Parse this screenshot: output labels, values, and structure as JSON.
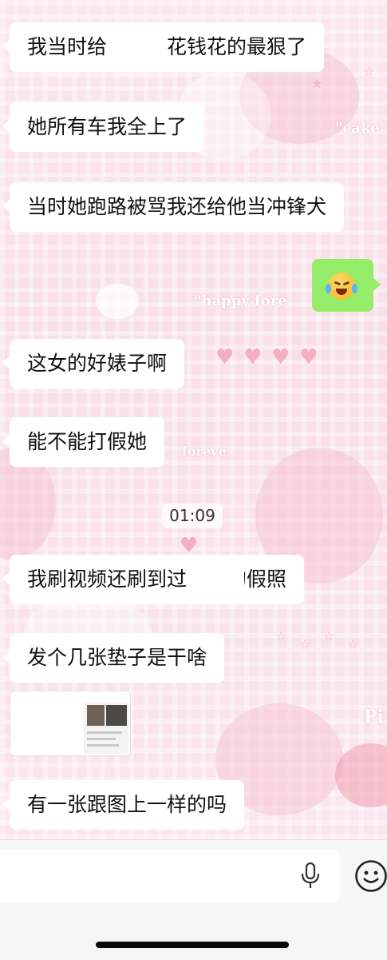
{
  "chat": {
    "messages": [
      {
        "side": "left",
        "text": "我当时给　　　花钱花的最狠了"
      },
      {
        "side": "left",
        "text": "她所有车我全上了"
      },
      {
        "side": "left",
        "text": "当时她跑路被骂我还给他当冲锋犬"
      },
      {
        "side": "right",
        "emoji": "crying-laughing-face"
      },
      {
        "side": "left",
        "text": "这女的好婊子啊"
      },
      {
        "side": "left",
        "text": "能不能打假她"
      },
      {
        "side": "left",
        "text": "我刷视频还刷到过　　的假照"
      },
      {
        "side": "left",
        "text": "发个几张垫子是干啥"
      },
      {
        "side": "left",
        "attachment": "screenshot-image"
      },
      {
        "side": "left",
        "text": "有一张跟图上一样的吗"
      }
    ],
    "timestamp": "01:09"
  },
  "wallpaper": {
    "texts": [
      "\"cake",
      "\"happy  fore",
      "foreve",
      "Pi"
    ]
  },
  "input_bar": {
    "placeholder": "",
    "icons": [
      "microphone-icon",
      "emoji-smile-icon"
    ]
  },
  "colors": {
    "bubble_left": "#ffffff",
    "bubble_right": "#95ec69",
    "background": "#fbe9ef"
  }
}
